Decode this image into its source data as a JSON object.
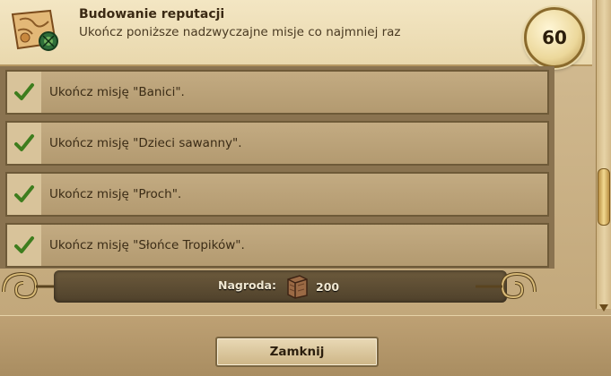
{
  "quest": {
    "title": "Budowanie reputacji",
    "description": "Ukończ poniższe nadzwyczajne misje co najmniej raz",
    "points": "60"
  },
  "tasks": [
    {
      "label": "Ukończ misję \"Banici\".",
      "completed": true
    },
    {
      "label": "Ukończ misję \"Dzieci sawanny\".",
      "completed": true
    },
    {
      "label": "Ukończ misję \"Proch\".",
      "completed": true
    },
    {
      "label": "Ukończ misję \"Słońce Tropików\".",
      "completed": true
    }
  ],
  "reward": {
    "label": "Nagroda:",
    "value": "200",
    "icon": "crate-icon"
  },
  "footer": {
    "close_label": "Zamknij"
  },
  "colors": {
    "check": "#3e7d1e",
    "row": "#b9a077",
    "reward_bar": "#5d4d33"
  }
}
